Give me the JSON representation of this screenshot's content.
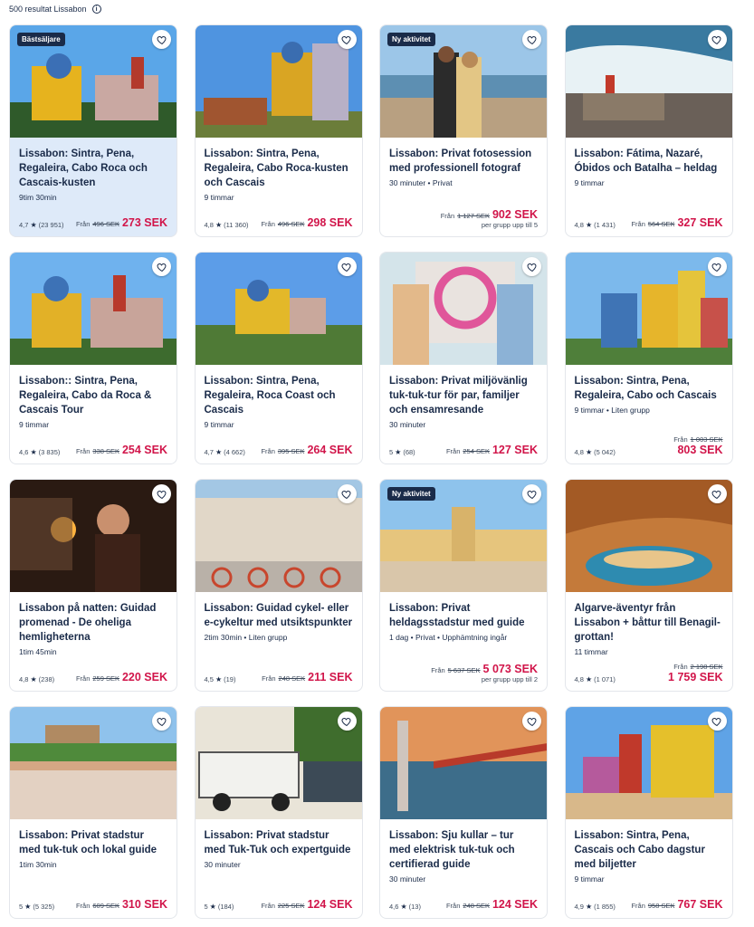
{
  "results": {
    "count_text": "500 resultat Lissabon"
  },
  "cards": [
    {
      "title": "Lissabon: Sintra, Pena, Regaleira, Cabo Roca och Cascais-kusten",
      "meta": "9tim 30min",
      "rating": "4,7",
      "reviews": "(23 951)",
      "from": "Från",
      "old": "496 SEK",
      "price": "273 SEK",
      "badge": "Bästsäljare"
    },
    {
      "title": "Lissabon: Sintra, Pena, Regaleira, Cabo Roca-kusten och Cascais",
      "meta": "9 timmar",
      "rating": "4,8",
      "reviews": "(11 360)",
      "from": "Från",
      "old": "496 SEK",
      "price": "298 SEK"
    },
    {
      "title": "Lissabon: Privat fotosession med professionell fotograf",
      "meta": "30 minuter • Privat",
      "from": "Från",
      "old": "1 127 SEK",
      "price": "902 SEK",
      "sub": "per grupp upp till 5",
      "badge": "Ny aktivitet"
    },
    {
      "title": "Lissabon: Fátima, Nazaré, Óbidos och Batalha – heldag",
      "meta": "9 timmar",
      "rating": "4,8",
      "reviews": "(1 431)",
      "from": "Från",
      "old": "564 SEK",
      "price": "327 SEK"
    },
    {
      "title": "Lissabon:: Sintra, Pena, Regaleira, Cabo da Roca & Cascais Tour",
      "meta": "9 timmar",
      "rating": "4,6",
      "reviews": "(3 835)",
      "from": "Från",
      "old": "338 SEK",
      "price": "254 SEK"
    },
    {
      "title": "Lissabon: Sintra, Pena, Regaleira, Roca Coast och Cascais",
      "meta": "9 timmar",
      "rating": "4,7",
      "reviews": "(4 662)",
      "from": "Från",
      "old": "395 SEK",
      "price": "264 SEK"
    },
    {
      "title": "Lissabon: Privat miljövänlig tuk-tuk-tur för par, familjer och ensamresande",
      "meta": "30 minuter",
      "rating": "5",
      "reviews": "(68)",
      "from": "Från",
      "old": "254 SEK",
      "price": "127 SEK"
    },
    {
      "title": "Lissabon: Sintra, Pena, Regaleira, Cabo och Cascais",
      "meta": "9 timmar • Liten grupp",
      "rating": "4,8",
      "reviews": "(5 042)",
      "from": "Från",
      "old": "1 003 SEK",
      "price": "803 SEK",
      "stacked": true
    },
    {
      "title": "Lissabon på natten: Guidad promenad - De oheliga hemligheterna",
      "meta": "1tim 45min",
      "rating": "4,8",
      "reviews": "(238)",
      "from": "Från",
      "old": "259 SEK",
      "price": "220 SEK"
    },
    {
      "title": "Lissabon: Guidad cykel- eller e-cykeltur med utsiktspunkter",
      "meta": "2tim 30min • Liten grupp",
      "rating": "4,5",
      "reviews": "(19)",
      "from": "Från",
      "old": "248 SEK",
      "price": "211 SEK"
    },
    {
      "title": "Lissabon: Privat heldagsstadstur med guide",
      "meta": "1 dag • Privat • Upphämtning ingår",
      "from": "Från",
      "old": "5 637 SEK",
      "price": "5 073 SEK",
      "sub": "per grupp upp till 2",
      "badge": "Ny aktivitet"
    },
    {
      "title": "Algarve-äventyr från Lissabon + båttur till Benagil-grottan!",
      "meta": "11 timmar",
      "rating": "4,8",
      "reviews": "(1 071)",
      "from": "Från",
      "old": "2 198 SEK",
      "price": "1 759 SEK",
      "stacked": true
    },
    {
      "title": "Lissabon: Privat stadstur med tuk-tuk och lokal guide",
      "meta": "1tim 30min",
      "rating": "5",
      "reviews": "(5 325)",
      "from": "Från",
      "old": "609 SEK",
      "price": "310 SEK"
    },
    {
      "title": "Lissabon: Privat stadstur med Tuk-Tuk och expertguide",
      "meta": "30 minuter",
      "rating": "5",
      "reviews": "(184)",
      "from": "Från",
      "old": "225 SEK",
      "price": "124 SEK"
    },
    {
      "title": "Lissabon: Sju kullar – tur med elektrisk tuk-tuk och certifierad guide",
      "meta": "30 minuter",
      "rating": "4,6",
      "reviews": "(13)",
      "from": "Från",
      "old": "248 SEK",
      "price": "124 SEK"
    },
    {
      "title": "Lissabon: Sintra, Pena, Cascais och Cabo dagstur med biljetter",
      "meta": "9 timmar",
      "rating": "4,9",
      "reviews": "(1 855)",
      "from": "Från",
      "old": "958 SEK",
      "price": "767 SEK"
    }
  ],
  "colors": {
    "price": "#d1154a",
    "text": "#1a2b49",
    "highlight": "#deeaf9"
  },
  "icons": {
    "favorite": "heart-outline-icon",
    "info": "info-circle-icon",
    "rating": "star-icon"
  }
}
